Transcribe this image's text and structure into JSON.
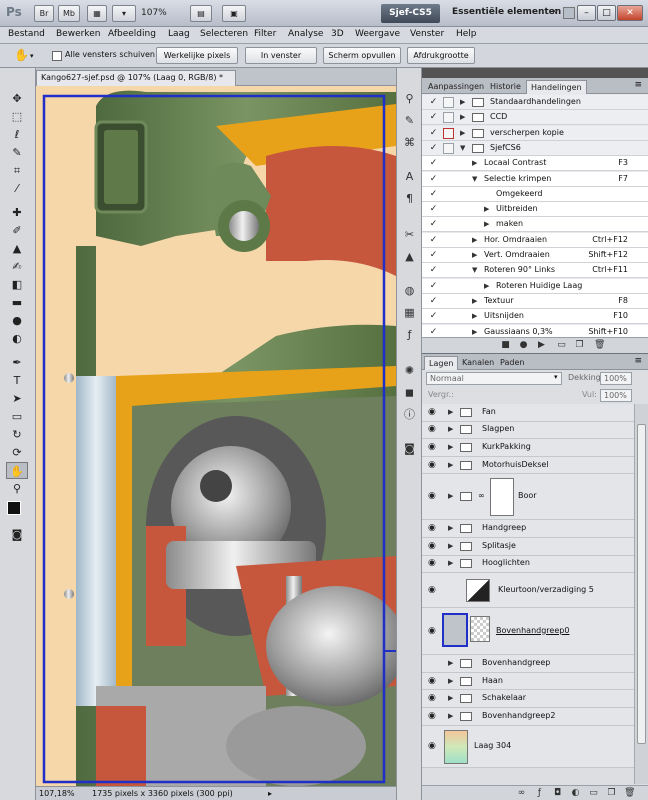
{
  "titlebar": {
    "logo": "Ps",
    "btn_br": "Br",
    "btn_mb": "Mb",
    "zoom": "107%",
    "workspace": "Sjef-CS5",
    "workspace_essentials": "Essentiële elementen",
    "minimize": "–",
    "restore": "□",
    "close": "✕"
  },
  "menu": [
    "Bestand",
    "Bewerken",
    "Afbeelding",
    "Laag",
    "Selecteren",
    "Filter",
    "Analyse",
    "3D",
    "Weergave",
    "Venster",
    "Help"
  ],
  "options": {
    "scroll_all_label": "Alle vensters schuiven",
    "actual_pixels": "Werkelijke pixels",
    "fit_screen": "In venster",
    "fill_screen": "Scherm opvullen",
    "print_size": "Afdrukgrootte"
  },
  "document": {
    "tab_title": "Kango627-sjef.psd @ 107% (Laag 0, RGB/8) *",
    "tab_close": "×",
    "zoom_status": "107,18%",
    "size_status": "1735 pixels x 3360 pixels (300 ppi)"
  },
  "actions_panel": {
    "tabs": [
      "Aanpassingen",
      "Historie",
      "Handelingen"
    ],
    "active_tab": 2,
    "rows": [
      {
        "name": "Standaardhandelingen",
        "type": "set",
        "indent": 0,
        "key": ""
      },
      {
        "name": "CCD",
        "type": "set",
        "indent": 0,
        "key": ""
      },
      {
        "name": "verscherpen kopie",
        "type": "set",
        "indent": 0,
        "key": ""
      },
      {
        "name": "SjefCS6",
        "type": "set",
        "indent": 0,
        "key": ""
      },
      {
        "name": "Locaal Contrast",
        "type": "action",
        "indent": 1,
        "key": "F3"
      },
      {
        "name": "Selectie krimpen",
        "type": "action",
        "indent": 1,
        "key": "F7"
      },
      {
        "name": "Omgekeerd",
        "type": "step",
        "indent": 2,
        "key": ""
      },
      {
        "name": "Uitbreiden",
        "type": "step",
        "indent": 2,
        "key": ""
      },
      {
        "name": "maken",
        "type": "step",
        "indent": 2,
        "key": ""
      },
      {
        "name": "Hor. Omdraaien",
        "type": "action",
        "indent": 1,
        "key": "Ctrl+F12"
      },
      {
        "name": "Vert. Omdraaien",
        "type": "action",
        "indent": 1,
        "key": "Shift+F12"
      },
      {
        "name": "Roteren 90° Links",
        "type": "action",
        "indent": 1,
        "key": "Ctrl+F11"
      },
      {
        "name": "Roteren Huidige Laag",
        "type": "step",
        "indent": 2,
        "key": ""
      },
      {
        "name": "Textuur",
        "type": "action",
        "indent": 1,
        "key": "F8"
      },
      {
        "name": "Uitsnijden",
        "type": "action",
        "indent": 1,
        "key": "F10"
      },
      {
        "name": "Gaussiaans 0,3%",
        "type": "action",
        "indent": 1,
        "key": "Shift+F10"
      }
    ]
  },
  "layers_panel": {
    "tabs": [
      "Lagen",
      "Kanalen",
      "Paden"
    ],
    "blend_mode": "Normaal",
    "opacity_label": "Dekking:",
    "opacity_value": "100%",
    "lock_label": "Vergr.:",
    "fill_label": "Vul:",
    "fill_value": "100%",
    "layers": [
      {
        "name": "Fan",
        "kind": "group"
      },
      {
        "name": "Slagpen",
        "kind": "group"
      },
      {
        "name": "KurkPakking",
        "kind": "group"
      },
      {
        "name": "MotorhuisDeksel",
        "kind": "group"
      },
      {
        "name": "Boor",
        "kind": "group-thumb"
      },
      {
        "name": "Handgreep",
        "kind": "group"
      },
      {
        "name": "Splitasje",
        "kind": "group"
      },
      {
        "name": "Hooglichten",
        "kind": "group"
      },
      {
        "name": "Kleurtoon/verzadiging 5",
        "kind": "adjustment"
      },
      {
        "name": "Bovenhandgreep0",
        "kind": "pixel"
      },
      {
        "name": "Bovenhandgreep",
        "kind": "group"
      },
      {
        "name": "Haan",
        "kind": "group"
      },
      {
        "name": "Schakelaar",
        "kind": "group"
      },
      {
        "name": "Bovenhandgreep2",
        "kind": "group"
      },
      {
        "name": "Laag 304",
        "kind": "gradient"
      }
    ]
  },
  "colors": {
    "selection_blue": "#1f2fc8",
    "cream_bg": "#f6d7aa",
    "green_body": "#5e7a4c",
    "rust_red": "#c6563c",
    "orange": "#e8a21a"
  }
}
